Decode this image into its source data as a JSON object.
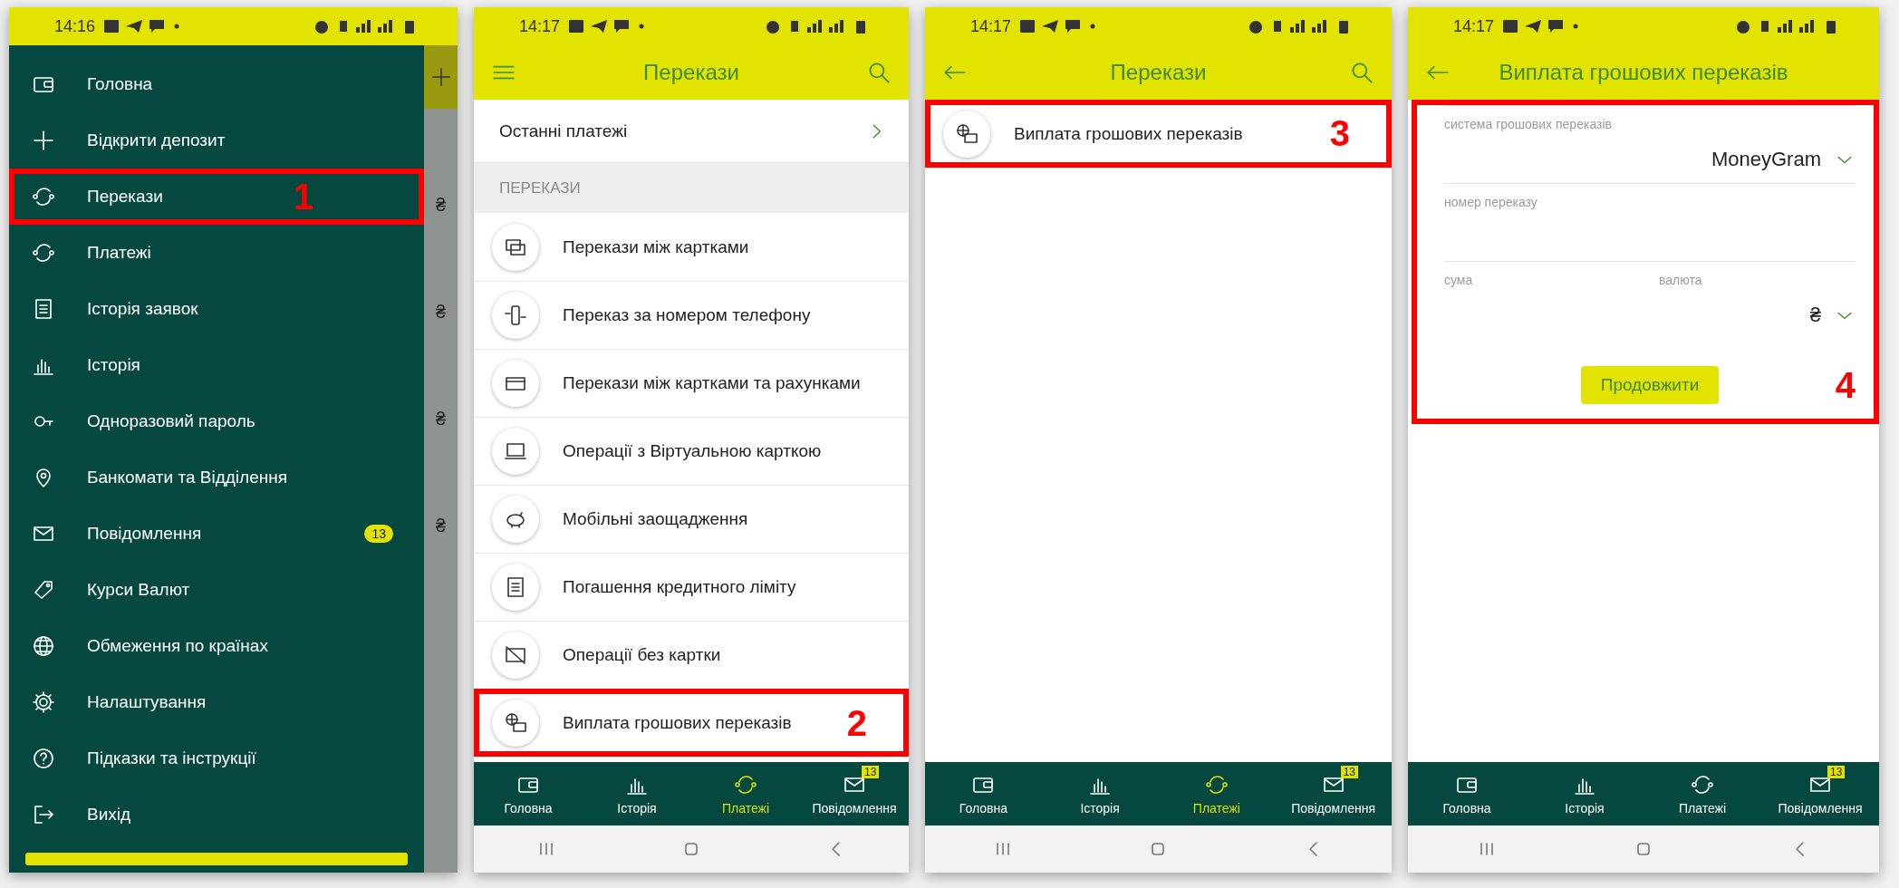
{
  "phones": [
    {
      "kind": "drawer",
      "status_bar": {
        "time": "14:16"
      },
      "menu": [
        {
          "label": "Головна"
        },
        {
          "label": "Відкрити депозит"
        },
        {
          "label": "Перекази",
          "callout": "1"
        },
        {
          "label": "Платежі"
        },
        {
          "label": "Історія заявок"
        },
        {
          "label": "Історія"
        },
        {
          "label": "Одноразовий пароль"
        },
        {
          "label": "Банкомати та Відділення"
        },
        {
          "label": "Повідомлення",
          "badge": "13"
        },
        {
          "label": "Курси Валют"
        },
        {
          "label": "Обмеження по країнах"
        },
        {
          "label": "Налаштування"
        },
        {
          "label": "Підказки та інструкції"
        },
        {
          "label": "Вихід"
        }
      ],
      "background_amounts": [
        "₴",
        "₴",
        "₴",
        "₴"
      ]
    },
    {
      "kind": "list",
      "status_bar": {
        "time": "14:17"
      },
      "app_bar": {
        "kind": "menu",
        "title": "Перекази",
        "search": true
      },
      "rows": [
        {
          "label": "Останні платежі"
        }
      ],
      "section": "ПЕРЕКАЗИ",
      "items": [
        {
          "label": "Перекази між картками"
        },
        {
          "label": "Переказ за номером телефону"
        },
        {
          "label": "Перекази між картками та рахунками"
        },
        {
          "label": "Операції з Віртуальною карткою"
        },
        {
          "label": "Мобільні заощадження"
        },
        {
          "label": "Погашення кредитного ліміту"
        },
        {
          "label": "Операції без картки"
        },
        {
          "label": "Виплата грошових переказів",
          "callout": "2"
        }
      ],
      "bottom_nav": [
        {
          "label": "Головна",
          "selected": false
        },
        {
          "label": "Історія",
          "selected": false
        },
        {
          "label": "Платежі",
          "selected": true
        },
        {
          "label": "Повідомлення",
          "selected": false,
          "badge": "13"
        }
      ]
    },
    {
      "kind": "list",
      "status_bar": {
        "time": "14:17"
      },
      "app_bar": {
        "kind": "back",
        "title": "Перекази",
        "search": true
      },
      "items": [
        {
          "label": "Виплата грошових переказів",
          "callout": "3"
        }
      ],
      "bottom_nav": [
        {
          "label": "Головна",
          "selected": false
        },
        {
          "label": "Історія",
          "selected": false
        },
        {
          "label": "Платежі",
          "selected": true
        },
        {
          "label": "Повідомлення",
          "selected": false,
          "badge": "13"
        }
      ]
    },
    {
      "kind": "form",
      "status_bar": {
        "time": "14:17"
      },
      "app_bar": {
        "kind": "back",
        "title": "Виплата грошових переказів",
        "search": false
      },
      "form": {
        "callout": "4",
        "rows": [
          [
            {
              "kind": "select",
              "label": "система грошових переказів",
              "value": "MoneyGram"
            }
          ],
          [
            {
              "kind": "input",
              "label": "номер переказу"
            }
          ],
          [
            {
              "kind": "input",
              "label": "сума"
            },
            {
              "kind": "select",
              "label": "валюта",
              "value": "₴"
            }
          ]
        ],
        "button": "Продовжити"
      },
      "bottom_nav": [
        {
          "label": "Головна",
          "selected": false
        },
        {
          "label": "Історія",
          "selected": false
        },
        {
          "label": "Платежі",
          "selected": false
        },
        {
          "label": "Повідомлення",
          "selected": false,
          "badge": "13"
        }
      ]
    }
  ]
}
